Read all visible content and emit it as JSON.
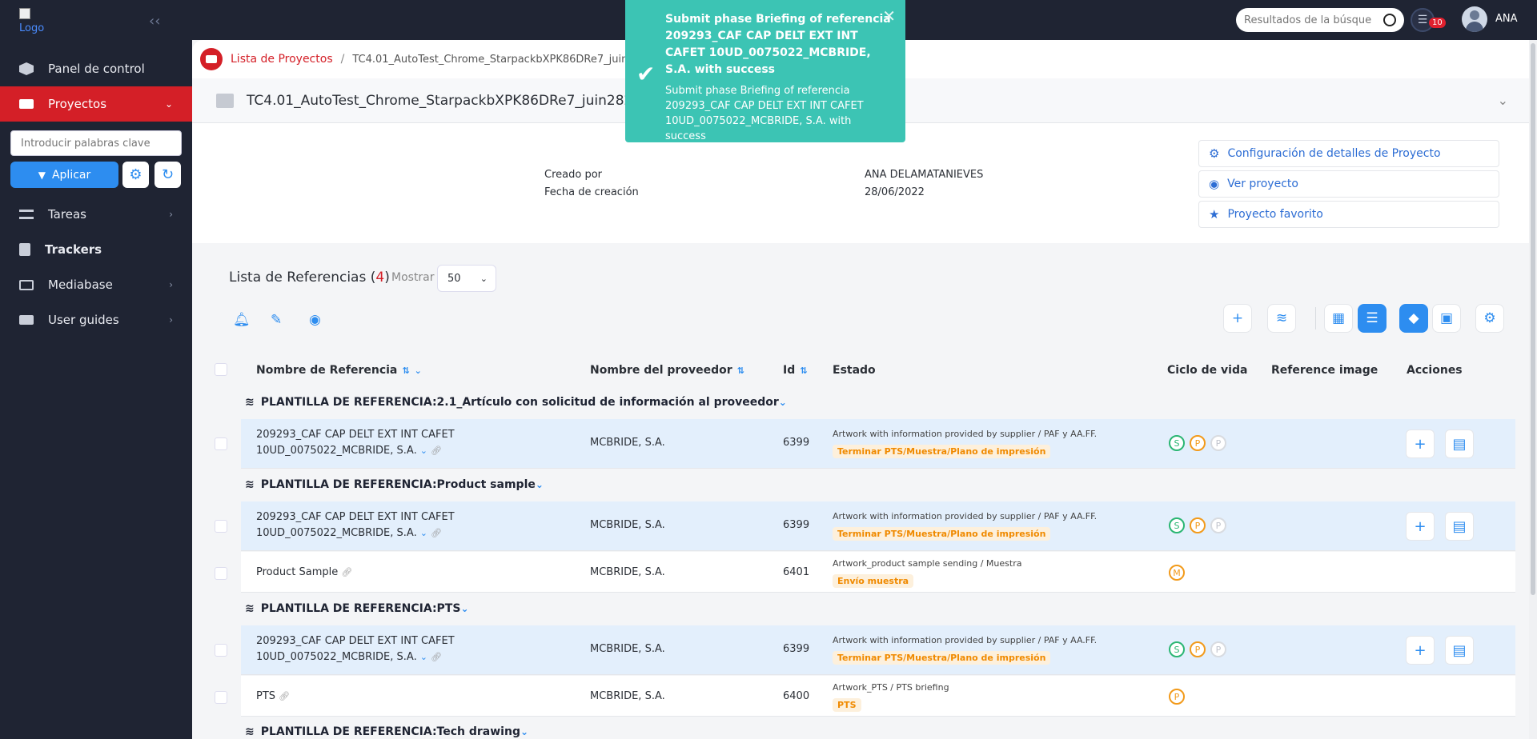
{
  "sidebar": {
    "logo_alt": "Logo",
    "items": [
      {
        "label": "Panel de control"
      },
      {
        "label": "Proyectos"
      },
      {
        "label": "Tareas"
      },
      {
        "label": "Trackers"
      },
      {
        "label": "Mediabase"
      },
      {
        "label": "User guides"
      }
    ],
    "keyword_placeholder": "Introducir palabras clave",
    "apply_label": "Aplicar"
  },
  "topbar": {
    "search_placeholder": "Resultados de la búsque",
    "notif_count": "10",
    "user_name": "ANA"
  },
  "breadcrumb": {
    "root": "Lista de Proyectos",
    "current": "TC4.01_AutoTest_Chrome_StarpackbXPK86DRe7_juin28"
  },
  "project": {
    "title": "TC4.01_AutoTest_Chrome_StarpackbXPK86DRe7_juin282022",
    "created_by_label": "Creado por",
    "created_by_value": "ANA DELAMATANIEVES",
    "created_date_label": "Fecha de creación",
    "created_date_value": "28/06/2022",
    "actions": [
      {
        "label": "Configuración de detalles de Proyecto"
      },
      {
        "label": "Ver proyecto"
      },
      {
        "label": "Proyecto favorito"
      }
    ]
  },
  "references": {
    "title": "Lista de Referencias (",
    "count": "4",
    "title_close": ")",
    "mostrar_label": "Mostrar",
    "page_size": "50",
    "columns": [
      "Nombre de Referencia",
      "Nombre del proveedor",
      "Id",
      "Estado",
      "Ciclo de vida",
      "Reference image",
      "Acciones"
    ],
    "groups": [
      {
        "label": "PLANTILLA DE REFERENCIA:2.1_Artículo con solicitud de información al proveedor"
      },
      {
        "label": "PLANTILLA DE REFERENCIA:Product sample"
      },
      {
        "label": "PLANTILLA DE REFERENCIA:PTS"
      },
      {
        "label": "PLANTILLA DE REFERENCIA:Tech drawing"
      }
    ],
    "rows": [
      {
        "name1": "209293_CAF CAP DELT EXT INT CAFET",
        "name2": "10UD_0075022_MCBRIDE, S.A.",
        "supplier": "MCBRIDE, S.A.",
        "id": "6399",
        "estado": "Artwork with information provided by supplier / PAF y AA.FF.",
        "badge": "Terminar PTS/Muestra/Plano de impresión"
      },
      {
        "name1": "209293_CAF CAP DELT EXT INT CAFET",
        "name2": "10UD_0075022_MCBRIDE, S.A.",
        "supplier": "MCBRIDE, S.A.",
        "id": "6399",
        "estado": "Artwork with information provided by supplier / PAF y AA.FF.",
        "badge": "Terminar PTS/Muestra/Plano de impresión"
      },
      {
        "name1": "Product Sample",
        "supplier": "MCBRIDE, S.A.",
        "id": "6401",
        "estado": "Artwork_product sample sending / Muestra",
        "badge": "Envío muestra"
      },
      {
        "name1": "209293_CAF CAP DELT EXT INT CAFET",
        "name2": "10UD_0075022_MCBRIDE, S.A.",
        "supplier": "MCBRIDE, S.A.",
        "id": "6399",
        "estado": "Artwork with information provided by supplier / PAF y AA.FF.",
        "badge": "Terminar PTS/Muestra/Plano de impresión"
      },
      {
        "name1": "PTS",
        "supplier": "MCBRIDE, S.A.",
        "id": "6400",
        "estado": "Artwork_PTS / PTS briefing",
        "badge": "PTS"
      }
    ],
    "lifecycle": {
      "s": "S",
      "p": "P",
      "m": "M"
    }
  },
  "toast": {
    "title": "Submit phase Briefing of referencia 209293_CAF CAP DELT EXT INT CAFET 10UD_0075022_MCBRIDE, S.A. with success",
    "message": "Submit phase Briefing of referencia 209293_CAF CAP DELT EXT INT CAFET 10UD_0075022_MCBRIDE, S.A. with success"
  }
}
